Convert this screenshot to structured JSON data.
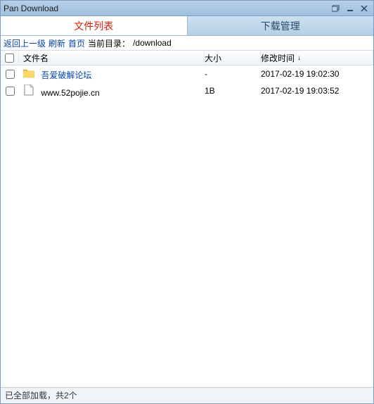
{
  "window": {
    "title": "Pan Download"
  },
  "tabs": [
    {
      "label": "文件列表",
      "active": true
    },
    {
      "label": "下载管理",
      "active": false
    }
  ],
  "nav": {
    "back": "返回上一级",
    "refresh": "刷新",
    "home": "首页",
    "cur_dir_label": "当前目录：",
    "cur_dir_value": "/download"
  },
  "columns": {
    "name": "文件名",
    "size": "大小",
    "time": "修改时间",
    "sort_indicator": "↓"
  },
  "files": [
    {
      "icon": "folder",
      "name": "吾爱破解论坛",
      "link": true,
      "size": "-",
      "time": "2017-02-19 19:02:30"
    },
    {
      "icon": "file",
      "name": "www.52pojie.cn",
      "link": false,
      "size": "1B",
      "time": "2017-02-19 19:03:52"
    }
  ],
  "status": "已全部加载，共2个"
}
